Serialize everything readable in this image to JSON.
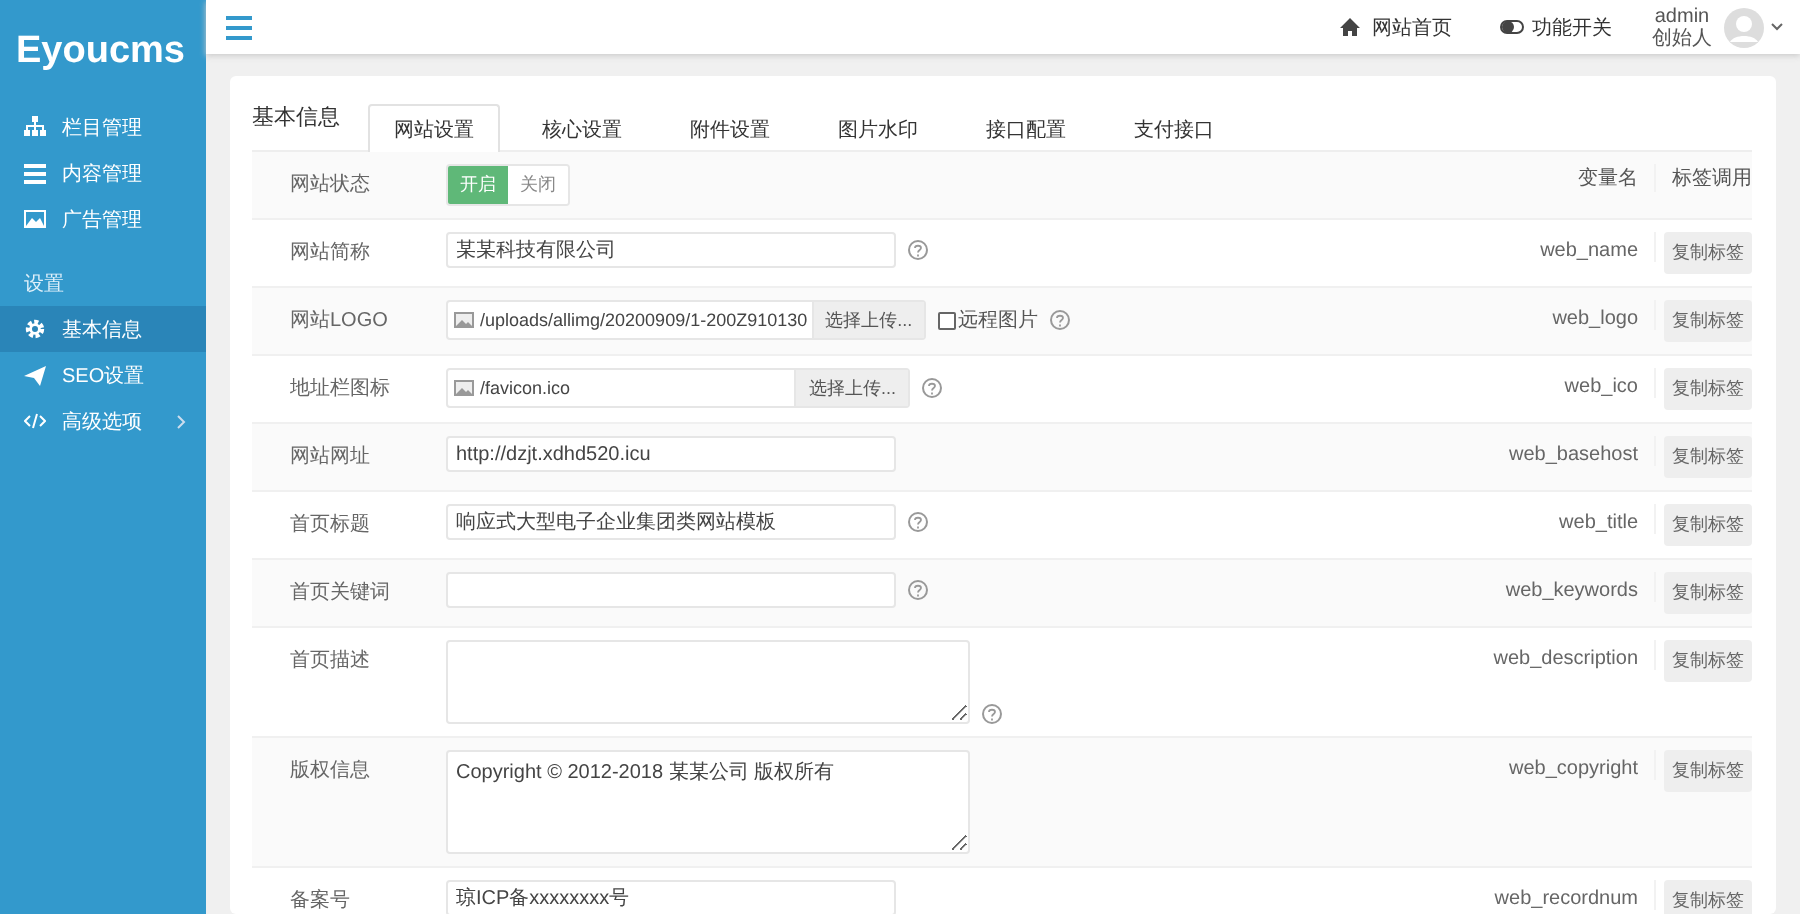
{
  "sidebar": {
    "logo": "Eyoucms",
    "groups": [
      {
        "items": [
          {
            "label": "栏目管理",
            "selected": false,
            "submenu": false
          },
          {
            "label": "内容管理",
            "selected": false,
            "submenu": false
          },
          {
            "label": "广告管理",
            "selected": false,
            "submenu": false
          }
        ]
      },
      {
        "title": "设置",
        "items": [
          {
            "label": "基本信息",
            "selected": true,
            "submenu": false
          },
          {
            "label": "SEO设置",
            "selected": false,
            "submenu": false
          },
          {
            "label": "高级选项",
            "selected": false,
            "submenu": true
          }
        ]
      }
    ]
  },
  "topbar": {
    "links": [
      {
        "label": "网站首页"
      },
      {
        "label": "功能开关"
      }
    ],
    "user": {
      "name": "admin",
      "role": "创始人"
    }
  },
  "card": {
    "title": "基本信息",
    "tabs": [
      {
        "label": "网站设置",
        "selected": true
      },
      {
        "label": "核心设置",
        "selected": false
      },
      {
        "label": "附件设置",
        "selected": false
      },
      {
        "label": "图片水印",
        "selected": false
      },
      {
        "label": "接口配置",
        "selected": false
      },
      {
        "label": "支付接口",
        "selected": false
      }
    ],
    "columns": [
      "变量名",
      "标签调用"
    ],
    "rows": [
      {
        "kind": "switch",
        "label": "网站状态",
        "options": [
          {
            "label": "开启",
            "selected": true
          },
          {
            "label": "关闭",
            "selected": false
          }
        ]
      },
      {
        "kind": "text",
        "label": "网站简称",
        "value": "某某科技有限公司",
        "help": true,
        "var": "web_name",
        "button": "复制标签"
      },
      {
        "kind": "upload",
        "label": "网站LOGO",
        "value": "/uploads/allimg/20200909/1-200Z910130",
        "upload": "选择上传...",
        "checkbox": {
          "label": "远程图片",
          "checked": false
        },
        "help": true,
        "var": "web_logo",
        "button": "复制标签"
      },
      {
        "kind": "upload",
        "label": "地址栏图标",
        "value": "/favicon.ico",
        "upload": "选择上传...",
        "help": true,
        "var": "web_ico",
        "button": "复制标签"
      },
      {
        "kind": "text",
        "label": "网站网址",
        "value": "http://dzjt.xdhd520.icu",
        "help": false,
        "var": "web_basehost",
        "button": "复制标签"
      },
      {
        "kind": "text",
        "label": "首页标题",
        "value": "响应式大型电子企业集团类网站模板",
        "help": true,
        "var": "web_title",
        "button": "复制标签"
      },
      {
        "kind": "text",
        "label": "首页关键词",
        "help": true,
        "var": "web_keywords",
        "button": "复制标签"
      },
      {
        "kind": "textarea",
        "label": "首页描述",
        "help": true,
        "var": "web_description",
        "button": "复制标签"
      },
      {
        "kind": "textarea",
        "label": "版权信息",
        "value": "Copyright © 2012-2018 某某公司 版权所有",
        "help": false,
        "var": "web_copyright",
        "button": "复制标签"
      },
      {
        "kind": "text",
        "label": "备案号",
        "value": "琼ICP备xxxxxxxx号",
        "help": false,
        "var": "web_recordnum",
        "button": "复制标签"
      }
    ]
  }
}
